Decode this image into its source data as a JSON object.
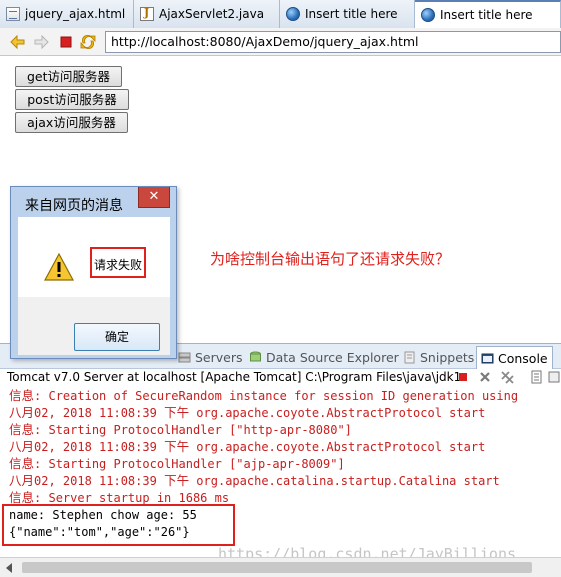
{
  "editor_tabs": [
    {
      "label": "jquery_ajax.html",
      "icon": "html-file-icon"
    },
    {
      "label": "AjaxServlet2.java",
      "icon": "java-file-icon"
    },
    {
      "label": "Insert title here",
      "icon": "globe-icon"
    },
    {
      "label": "Insert title here",
      "icon": "globe-icon"
    }
  ],
  "browser": {
    "url": "http://localhost:8080/AjaxDemo/jquery_ajax.html"
  },
  "page": {
    "buttons": [
      "get访问服务器",
      "post访问服务器",
      "ajax访问服务器"
    ],
    "annotation": "为啥控制台输出语句了还请求失败？"
  },
  "dialog": {
    "title": "来自网页的消息",
    "close_label": "✕",
    "message": "请求失败",
    "ok_label": "确定"
  },
  "views": {
    "tabs": [
      "Servers",
      "Data Source Explorer",
      "Snippets",
      "Console"
    ],
    "active": "Console"
  },
  "console": {
    "header": "Tomcat v7.0 Server at localhost [Apache Tomcat] C:\\Program Files\\java\\jdk1.",
    "lines": [
      {
        "cjk": "信息",
        "text": ": Creation of SecureRandom instance for session ID generation using"
      },
      {
        "cjk": "八月",
        "text": "02, 2018 11:08:39 ",
        "cjk2": "下午",
        "text2": " org.apache.coyote.AbstractProtocol start"
      },
      {
        "cjk": "信息",
        "text": ": Starting ProtocolHandler [\"http-apr-8080\"]"
      },
      {
        "cjk": "八月",
        "text": "02, 2018 11:08:39 ",
        "cjk2": "下午",
        "text2": " org.apache.coyote.AbstractProtocol start"
      },
      {
        "cjk": "信息",
        "text": ": Starting ProtocolHandler [\"ajp-apr-8009\"]"
      },
      {
        "cjk": "八月",
        "text": "02, 2018 11:08:39 ",
        "cjk2": "下午",
        "text2": " org.apache.catalina.startup.Catalina start"
      },
      {
        "cjk": "信息",
        "text": ": Server startup in 1686 ms"
      }
    ],
    "output": [
      "name: Stephen chow age: 55",
      "{\"name\":\"tom\",\"age\":\"26\"}"
    ],
    "error_color": "#c81e1e"
  },
  "watermark": "https://blog.csdn.net/JayBillions",
  "colors": {
    "highlight_red": "#e0201c",
    "dialog_frame": "#bcd2ec"
  }
}
